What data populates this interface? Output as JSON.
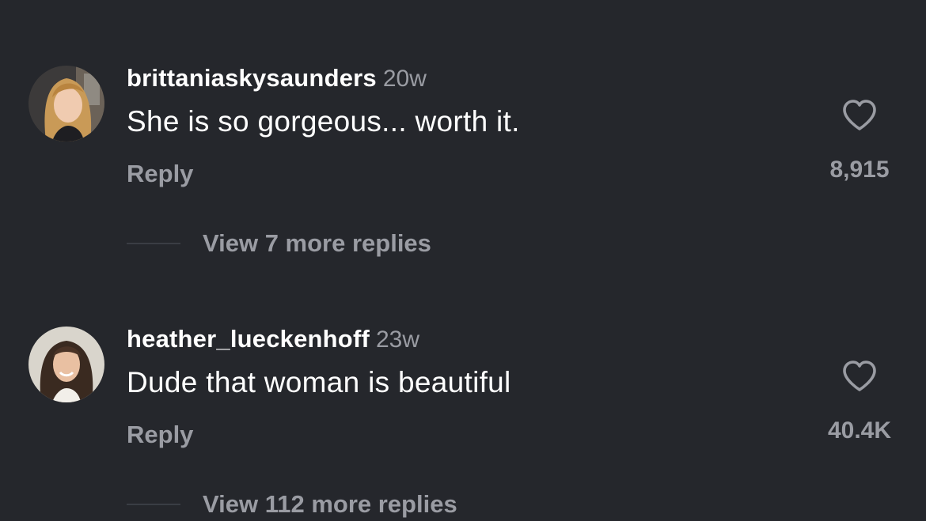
{
  "colors": {
    "background": "#25272c",
    "primary_text": "#ffffff",
    "secondary_text": "#9a9ca3",
    "divider": "#3a3d44"
  },
  "comments": [
    {
      "username": "brittaniaskysaunders",
      "time": "20w",
      "text": "She is so gorgeous... worth it.",
      "reply_label": "Reply",
      "likes": "8,915",
      "like_icon": "heart-outline-icon",
      "view_replies_label": "View 7 more replies"
    },
    {
      "username": "heather_lueckenhoff",
      "time": "23w",
      "text": "Dude that woman is beautiful",
      "reply_label": "Reply",
      "likes": "40.4K",
      "like_icon": "heart-outline-icon",
      "view_replies_label": "View 112 more replies"
    }
  ]
}
